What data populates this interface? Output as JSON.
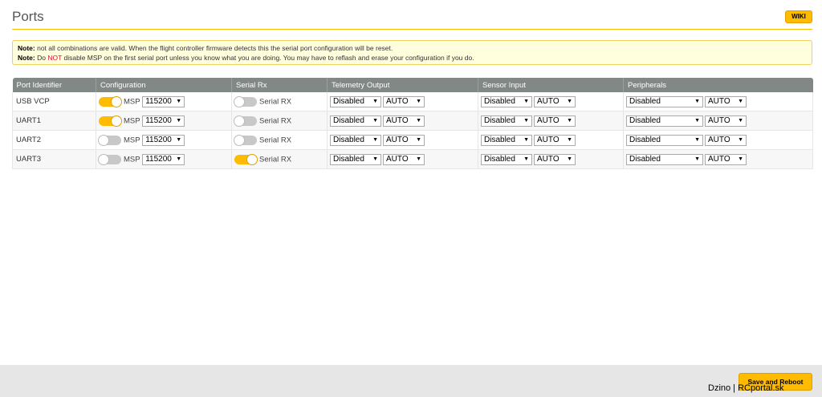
{
  "header": {
    "title": "Ports",
    "wiki_label": "WIKI"
  },
  "notes": {
    "note1_prefix": "Note:",
    "note1_text": " not all combinations are valid. When the flight controller firmware detects this the serial port configuration will be reset.",
    "note2_prefix": "Note:",
    "note2_text_a": " Do ",
    "note2_highlight": "NOT",
    "note2_text_b": " disable MSP on the first serial port unless you know what you are doing. You may have to reflash and erase your configuration if you do."
  },
  "table": {
    "headers": [
      "Port Identifier",
      "Configuration",
      "Serial Rx",
      "Telemetry Output",
      "Sensor Input",
      "Peripherals"
    ],
    "msp_label": "MSP",
    "serial_rx_label": "Serial RX",
    "rows": [
      {
        "port": "USB VCP",
        "msp_on": true,
        "msp_baud": "115200",
        "serial_rx_on": false,
        "telemetry": "Disabled",
        "telemetry_baud": "AUTO",
        "sensor": "Disabled",
        "sensor_baud": "AUTO",
        "peripheral": "Disabled",
        "peripheral_baud": "AUTO"
      },
      {
        "port": "UART1",
        "msp_on": true,
        "msp_baud": "115200",
        "serial_rx_on": false,
        "telemetry": "Disabled",
        "telemetry_baud": "AUTO",
        "sensor": "Disabled",
        "sensor_baud": "AUTO",
        "peripheral": "Disabled",
        "peripheral_baud": "AUTO"
      },
      {
        "port": "UART2",
        "msp_on": false,
        "msp_baud": "115200",
        "serial_rx_on": false,
        "telemetry": "Disabled",
        "telemetry_baud": "AUTO",
        "sensor": "Disabled",
        "sensor_baud": "AUTO",
        "peripheral": "Disabled",
        "peripheral_baud": "AUTO"
      },
      {
        "port": "UART3",
        "msp_on": false,
        "msp_baud": "115200",
        "serial_rx_on": true,
        "telemetry": "Disabled",
        "telemetry_baud": "AUTO",
        "sensor": "Disabled",
        "sensor_baud": "AUTO",
        "peripheral": "Disabled",
        "peripheral_baud": "AUTO"
      }
    ]
  },
  "footer": {
    "save_label": "Save and Reboot"
  },
  "watermark": "Dzino | RCportal.sk",
  "colors": {
    "accent": "#ffbb00",
    "header_bg": "#828885",
    "note_bg": "#ffffdd",
    "warning_red": "#e2123f"
  },
  "icons": {
    "dropdown": "chevron-down-icon"
  }
}
